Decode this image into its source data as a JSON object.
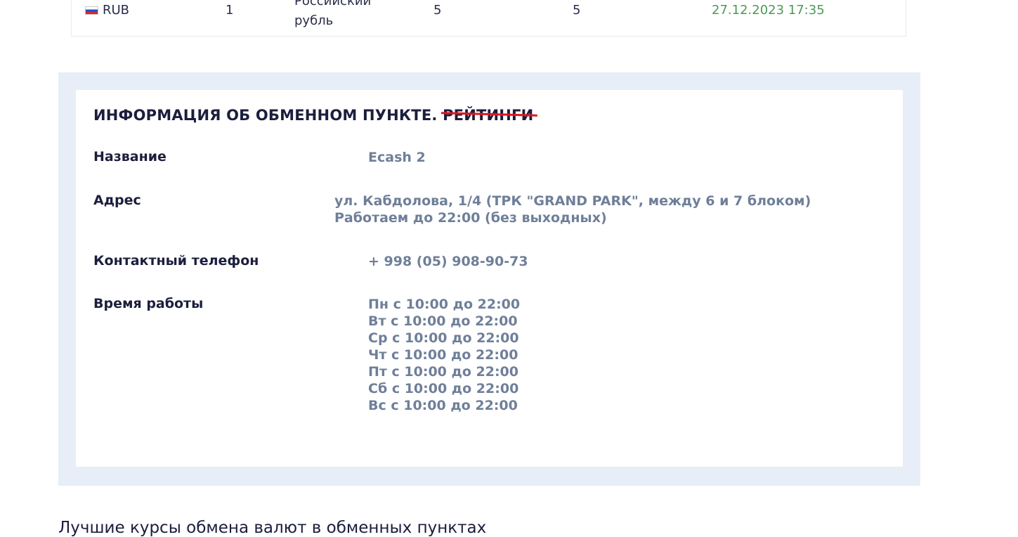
{
  "rate_row": {
    "code": "RUB",
    "flag_icon": "russia-flag-icon",
    "nominal": "1",
    "name_line1": "Российский",
    "name_line2": "рубль",
    "buy": "5",
    "sell": "5",
    "updated": "27.12.2023 17:35",
    "updated_color": "#4b9a56"
  },
  "info": {
    "title": "ИНФОРМАЦИЯ ОБ ОБМЕННОМ ПУНКТЕ.",
    "title_struck": "РЕЙТИНГИ",
    "name_label": "Название",
    "name_value": "Ecash 2",
    "address_label": "Адрес",
    "address_value": "ул. Кабдолова, 1/4 (ТРК \"GRAND PARK\", между 6 и 7 блоком) Работаем до 22:00 (без выходных)",
    "phone_label": "Контактный телефон",
    "phone_value": "+ 998 (05) 908-90-73",
    "hours_label": "Время работы",
    "hours": [
      "Пн с 10:00 до 22:00",
      "Вт с 10:00 до 22:00",
      "Ср с 10:00 до 22:00",
      "Чт с 10:00 до 22:00",
      "Пт с 10:00 до 22:00",
      "Сб с 10:00 до 22:00",
      "Вс с 10:00 до 22:00"
    ]
  },
  "bottom_heading": "Лучшие курсы обмена валют в обменных пунктах",
  "colors": {
    "panel_bg": "#e7eef8",
    "strike": "#e0161d",
    "value_text": "#6f7f99",
    "label_text": "#1b1e3c"
  }
}
